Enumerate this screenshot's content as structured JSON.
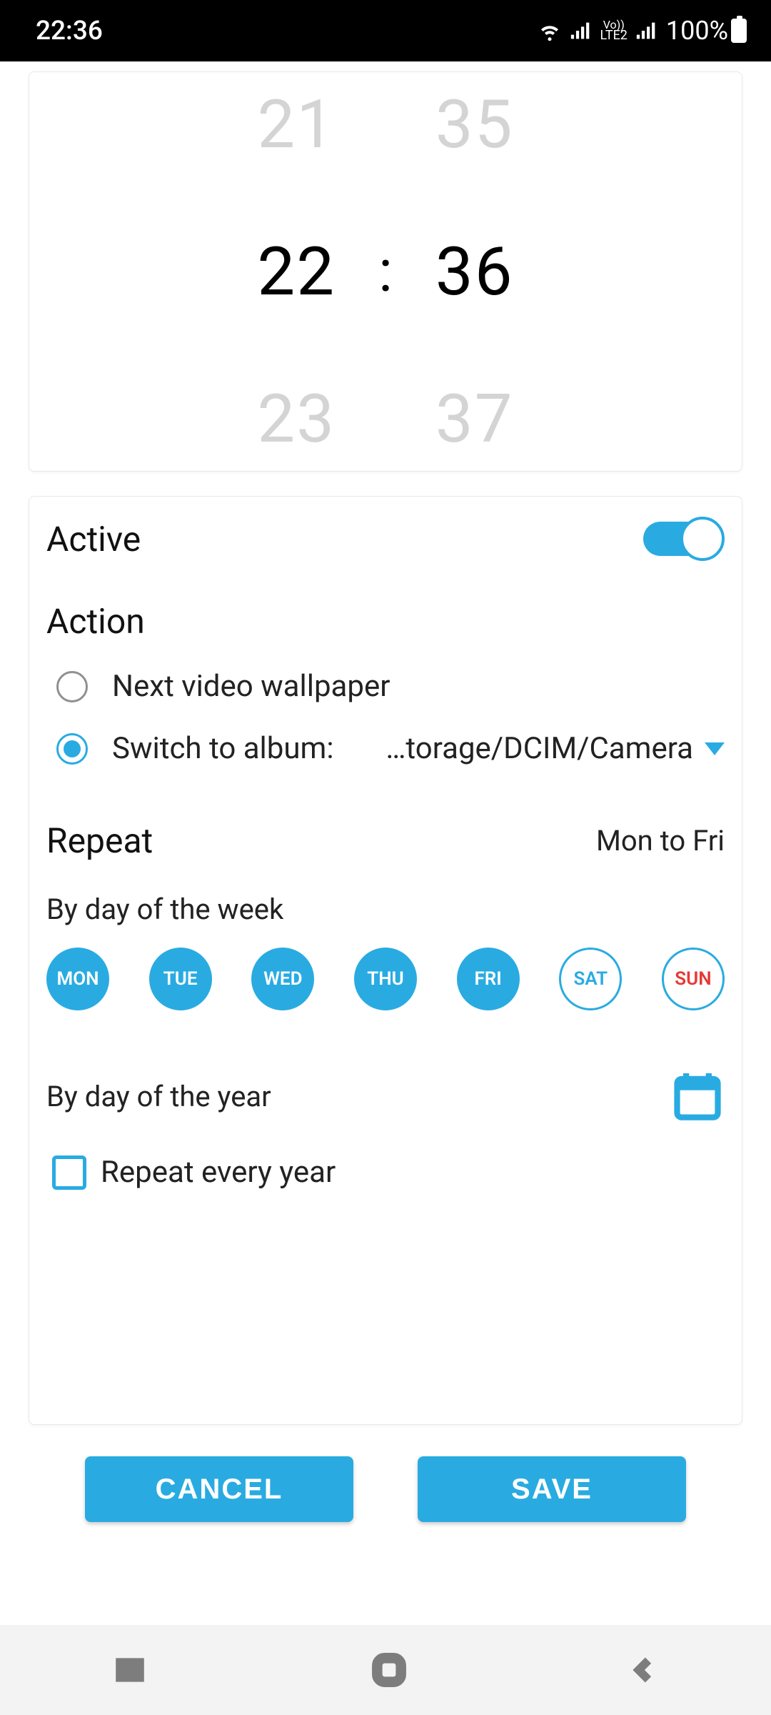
{
  "status": {
    "time": "22:36",
    "battery": "100%"
  },
  "time_picker": {
    "hour_prev": "21",
    "hour_sel": "22",
    "hour_next": "23",
    "min_prev": "35",
    "min_sel": "36",
    "min_next": "37",
    "sep": ":"
  },
  "active": {
    "label": "Active",
    "on": true
  },
  "action": {
    "title": "Action",
    "options": [
      {
        "label": "Next video wallpaper",
        "checked": false
      },
      {
        "label": "Switch to album:",
        "checked": true
      }
    ],
    "album_value": "…torage/DCIM/Camera"
  },
  "repeat": {
    "title": "Repeat",
    "summary": "Mon to Fri",
    "by_week_label": "By day of the week",
    "days": [
      {
        "short": "MON",
        "on": true
      },
      {
        "short": "TUE",
        "on": true
      },
      {
        "short": "WED",
        "on": true
      },
      {
        "short": "THU",
        "on": true
      },
      {
        "short": "FRI",
        "on": true
      },
      {
        "short": "SAT",
        "on": false
      },
      {
        "short": "SUN",
        "on": false,
        "sun": true
      }
    ],
    "by_year_label": "By day of the year",
    "repeat_year_label": "Repeat every year",
    "repeat_year_checked": false
  },
  "buttons": {
    "cancel": "CANCEL",
    "save": "SAVE"
  }
}
